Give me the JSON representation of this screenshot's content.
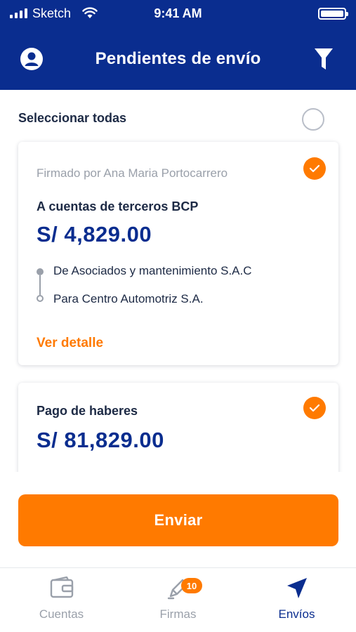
{
  "status_bar": {
    "carrier": "Sketch",
    "time": "9:41 AM"
  },
  "header": {
    "title": "Pendientes de envío"
  },
  "select_all": {
    "label": "Seleccionar todas"
  },
  "cards": [
    {
      "signed_by": "Firmado por Ana Maria Portocarrero",
      "title": "A cuentas de terceros BCP",
      "amount": "S/ 4,829.00",
      "from": "De Asociados y mantenimiento S.A.C",
      "to": "Para Centro Automotriz S.A.",
      "link": "Ver detalle",
      "selected": true
    },
    {
      "title": "Pago de haberes",
      "amount": "S/ 81,829.00",
      "selected": true
    }
  ],
  "send_button": "Enviar",
  "tabs": [
    {
      "label": "Cuentas",
      "icon": "wallet-icon",
      "active": false
    },
    {
      "label": "Firmas",
      "icon": "pen-icon",
      "badge": "10",
      "active": false
    },
    {
      "label": "Envíos",
      "icon": "send-arrow-icon",
      "active": true
    }
  ],
  "colors": {
    "primary": "#0a2d8f",
    "accent": "#ff7a00",
    "muted": "#9aa0aa",
    "text": "#1d2a45"
  }
}
